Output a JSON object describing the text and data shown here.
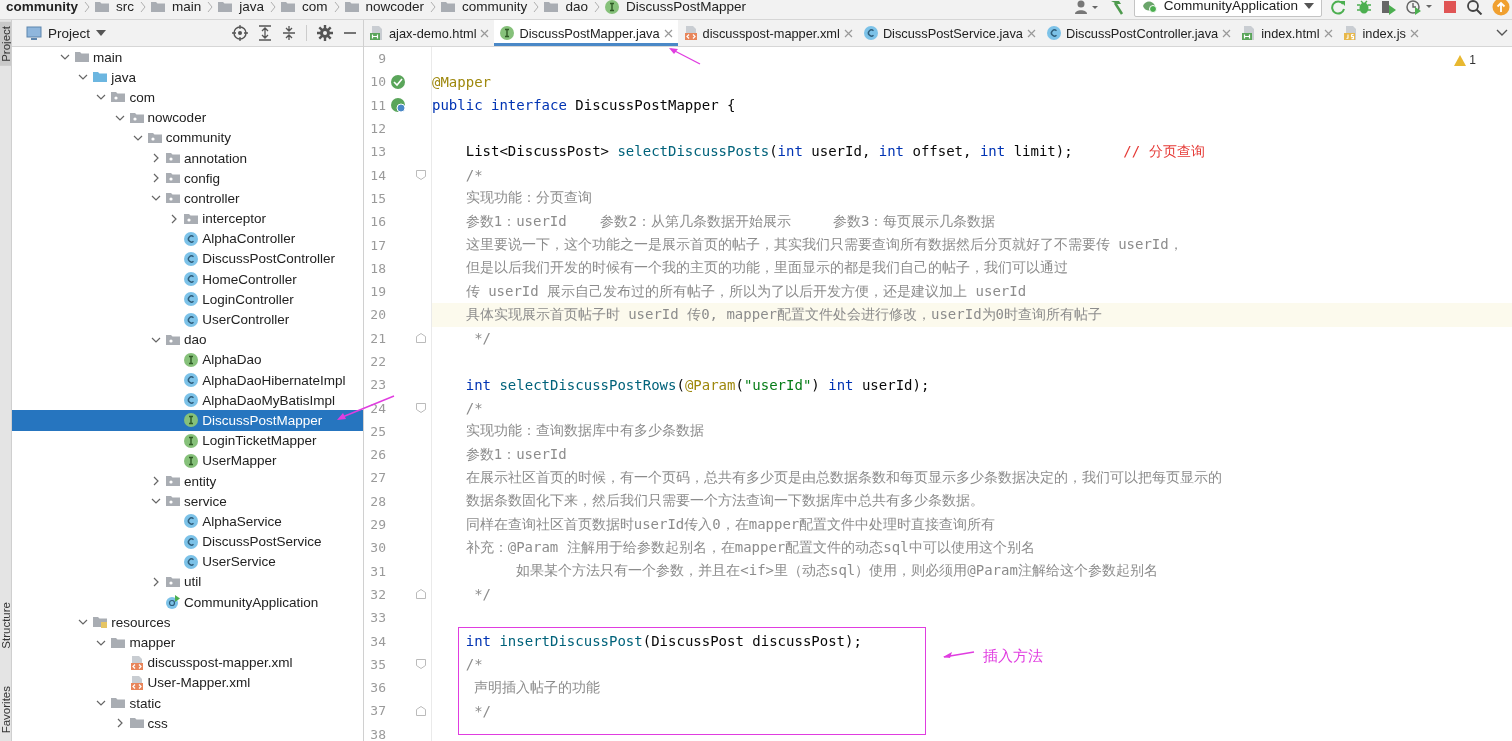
{
  "breadcrumb": [
    {
      "label": "community",
      "kind": "project"
    },
    {
      "label": "src",
      "kind": "folder"
    },
    {
      "label": "main",
      "kind": "folder"
    },
    {
      "label": "java",
      "kind": "folder"
    },
    {
      "label": "com",
      "kind": "folder"
    },
    {
      "label": "nowcoder",
      "kind": "folder"
    },
    {
      "label": "community",
      "kind": "folder"
    },
    {
      "label": "dao",
      "kind": "folder"
    },
    {
      "label": "DiscussPostMapper",
      "kind": "interface"
    }
  ],
  "toolbar": {
    "run_config": "CommunityApplication"
  },
  "tool_strip": [
    {
      "label": "Project",
      "selected": true
    },
    {
      "label": "Structure",
      "selected": false
    },
    {
      "label": "Favorites",
      "selected": false
    }
  ],
  "project_panel": {
    "title": "Project",
    "tree": [
      {
        "label": "main",
        "kind": "folder",
        "expanded": true,
        "selected": false,
        "children": [
          {
            "label": "java",
            "kind": "source-root",
            "expanded": true,
            "selected": false,
            "children": [
              {
                "label": "com",
                "kind": "package",
                "expanded": true,
                "selected": false,
                "children": [
                  {
                    "label": "nowcoder",
                    "kind": "package",
                    "expanded": true,
                    "selected": false,
                    "children": [
                      {
                        "label": "community",
                        "kind": "package",
                        "expanded": true,
                        "selected": false,
                        "children": [
                          {
                            "label": "annotation",
                            "kind": "package",
                            "expanded": false,
                            "selected": false
                          },
                          {
                            "label": "config",
                            "kind": "package",
                            "expanded": false,
                            "selected": false
                          },
                          {
                            "label": "controller",
                            "kind": "package",
                            "expanded": true,
                            "selected": false,
                            "children": [
                              {
                                "label": "interceptor",
                                "kind": "package",
                                "expanded": false,
                                "selected": false
                              },
                              {
                                "label": "AlphaController",
                                "kind": "class",
                                "selected": false
                              },
                              {
                                "label": "DiscussPostController",
                                "kind": "class",
                                "selected": false
                              },
                              {
                                "label": "HomeController",
                                "kind": "class",
                                "selected": false
                              },
                              {
                                "label": "LoginController",
                                "kind": "class",
                                "selected": false
                              },
                              {
                                "label": "UserController",
                                "kind": "class",
                                "selected": false
                              }
                            ]
                          },
                          {
                            "label": "dao",
                            "kind": "package",
                            "expanded": true,
                            "selected": false,
                            "children": [
                              {
                                "label": "AlphaDao",
                                "kind": "interface",
                                "selected": false
                              },
                              {
                                "label": "AlphaDaoHibernateImpl",
                                "kind": "class",
                                "selected": false
                              },
                              {
                                "label": "AlphaDaoMyBatisImpl",
                                "kind": "class",
                                "selected": false
                              },
                              {
                                "label": "DiscussPostMapper",
                                "kind": "interface",
                                "selected": true
                              },
                              {
                                "label": "LoginTicketMapper",
                                "kind": "interface",
                                "selected": false
                              },
                              {
                                "label": "UserMapper",
                                "kind": "interface",
                                "selected": false
                              }
                            ]
                          },
                          {
                            "label": "entity",
                            "kind": "package",
                            "expanded": false,
                            "selected": false
                          },
                          {
                            "label": "service",
                            "kind": "package",
                            "expanded": true,
                            "selected": false,
                            "children": [
                              {
                                "label": "AlphaService",
                                "kind": "class",
                                "selected": false
                              },
                              {
                                "label": "DiscussPostService",
                                "kind": "class",
                                "selected": false
                              },
                              {
                                "label": "UserService",
                                "kind": "class",
                                "selected": false
                              }
                            ]
                          },
                          {
                            "label": "util",
                            "kind": "package",
                            "expanded": false,
                            "selected": false
                          },
                          {
                            "label": "CommunityApplication",
                            "kind": "app",
                            "selected": false
                          }
                        ]
                      }
                    ]
                  }
                ]
              }
            ]
          },
          {
            "label": "resources",
            "kind": "resources-root",
            "expanded": true,
            "selected": false,
            "children": [
              {
                "label": "mapper",
                "kind": "folder",
                "expanded": true,
                "selected": false,
                "children": [
                  {
                    "label": "discusspost-mapper.xml",
                    "kind": "xml",
                    "selected": false
                  },
                  {
                    "label": "User-Mapper.xml",
                    "kind": "xml",
                    "selected": false
                  }
                ]
              },
              {
                "label": "static",
                "kind": "folder",
                "expanded": true,
                "selected": false,
                "children": [
                  {
                    "label": "css",
                    "kind": "folder",
                    "expanded": false,
                    "selected": false
                  }
                ]
              }
            ]
          }
        ]
      }
    ]
  },
  "editor": {
    "tabs": [
      {
        "label": "ajax-demo.html",
        "kind": "html",
        "selected": false
      },
      {
        "label": "DiscussPostMapper.java",
        "kind": "interface",
        "selected": true
      },
      {
        "label": "discusspost-mapper.xml",
        "kind": "xml",
        "selected": false
      },
      {
        "label": "DiscussPostService.java",
        "kind": "class",
        "selected": false
      },
      {
        "label": "DiscussPostController.java",
        "kind": "class",
        "selected": false
      },
      {
        "label": "index.html",
        "kind": "html",
        "selected": false
      },
      {
        "label": "index.js",
        "kind": "js",
        "selected": false
      }
    ],
    "warnings": "1",
    "callout": "插入方法",
    "lines": [
      {
        "number": "9",
        "current": false,
        "framed": false
      },
      {
        "number": "10",
        "gutter_icon": {
          "kind": "bean"
        },
        "current": false,
        "framed": false,
        "tokens": [
          {
            "kind": "annotation",
            "text": "@Mapper"
          }
        ]
      },
      {
        "number": "11",
        "gutter_icon": {
          "kind": "implemented"
        },
        "current": false,
        "framed": false,
        "tokens": [
          {
            "kind": "keyword",
            "text": "public interface "
          },
          {
            "kind": "plain",
            "text": "DiscussPostMapper {"
          }
        ]
      },
      {
        "number": "12",
        "current": false,
        "framed": false
      },
      {
        "number": "13",
        "current": false,
        "framed": false,
        "tokens": [
          {
            "kind": "plain",
            "text": "    List<DiscussPost> "
          },
          {
            "kind": "method",
            "text": "selectDiscussPosts"
          },
          {
            "kind": "plain",
            "text": "("
          },
          {
            "kind": "keyword",
            "text": "int"
          },
          {
            "kind": "plain",
            "text": " userId, "
          },
          {
            "kind": "keyword",
            "text": "int"
          },
          {
            "kind": "plain",
            "text": " offset, "
          },
          {
            "kind": "keyword",
            "text": "int"
          },
          {
            "kind": "plain",
            "text": " limit);      "
          },
          {
            "kind": "marked-comment",
            "text": "// 分页查询"
          }
        ]
      },
      {
        "number": "14",
        "fold_marker": {
          "kind": "start"
        },
        "current": false,
        "framed": false,
        "tokens": [
          {
            "kind": "comment",
            "text": "    /*"
          }
        ]
      },
      {
        "number": "15",
        "current": false,
        "framed": false,
        "tokens": [
          {
            "kind": "comment",
            "text": "    实现功能：分页查询"
          }
        ]
      },
      {
        "number": "16",
        "current": false,
        "framed": false,
        "tokens": [
          {
            "kind": "comment",
            "text": "    参数1：userId    参数2：从第几条数据开始展示     参数3：每页展示几条数据"
          }
        ]
      },
      {
        "number": "17",
        "current": false,
        "framed": false,
        "tokens": [
          {
            "kind": "comment",
            "text": "    这里要说一下，这个功能之一是展示首页的帖子，其实我们只需要查询所有数据然后分页就好了不需要传 userId，"
          }
        ]
      },
      {
        "number": "18",
        "current": false,
        "framed": false,
        "tokens": [
          {
            "kind": "comment",
            "text": "    但是以后我们开发的时候有一个我的主页的功能，里面显示的都是我们自己的帖子，我们可以通过"
          }
        ]
      },
      {
        "number": "19",
        "current": false,
        "framed": false,
        "tokens": [
          {
            "kind": "comment",
            "text": "    传 userId 展示自己发布过的所有帖子，所以为了以后开发方便，还是建议加上 userId"
          }
        ]
      },
      {
        "number": "20",
        "current": true,
        "framed": false,
        "tokens": [
          {
            "kind": "comment",
            "text": "    具体实现展示首页帖子时 userId 传0, mapper配置文件处会进行修改，userId为0时查询所有帖子"
          }
        ]
      },
      {
        "number": "21",
        "fold_marker": {
          "kind": "end"
        },
        "current": false,
        "framed": false,
        "tokens": [
          {
            "kind": "comment",
            "text": "     */"
          }
        ]
      },
      {
        "number": "22",
        "current": false,
        "framed": false
      },
      {
        "number": "23",
        "current": false,
        "framed": false,
        "tokens": [
          {
            "kind": "keyword",
            "text": "    int "
          },
          {
            "kind": "method",
            "text": "selectDiscussPostRows"
          },
          {
            "kind": "plain",
            "text": "("
          },
          {
            "kind": "annotation",
            "text": "@Param"
          },
          {
            "kind": "plain",
            "text": "("
          },
          {
            "kind": "string",
            "text": "\"userId\""
          },
          {
            "kind": "plain",
            "text": ") "
          },
          {
            "kind": "keyword",
            "text": "int"
          },
          {
            "kind": "plain",
            "text": " userId);"
          }
        ]
      },
      {
        "number": "24",
        "fold_marker": {
          "kind": "start"
        },
        "current": false,
        "framed": false,
        "tokens": [
          {
            "kind": "comment",
            "text": "    /*"
          }
        ]
      },
      {
        "number": "25",
        "current": false,
        "framed": false,
        "tokens": [
          {
            "kind": "comment",
            "text": "    实现功能：查询数据库中有多少条数据"
          }
        ]
      },
      {
        "number": "26",
        "current": false,
        "framed": false,
        "tokens": [
          {
            "kind": "comment",
            "text": "    参数1：userId"
          }
        ]
      },
      {
        "number": "27",
        "current": false,
        "framed": false,
        "tokens": [
          {
            "kind": "comment",
            "text": "    在展示社区首页的时候，有一个页码，总共有多少页是由总数据条数和每页显示多少条数据决定的，我们可以把每页显示的"
          }
        ]
      },
      {
        "number": "28",
        "current": false,
        "framed": false,
        "tokens": [
          {
            "kind": "comment",
            "text": "    数据条数固化下来，然后我们只需要一个方法查询一下数据库中总共有多少条数据。"
          }
        ]
      },
      {
        "number": "29",
        "current": false,
        "framed": false,
        "tokens": [
          {
            "kind": "comment",
            "text": "    同样在查询社区首页数据时userId传入0，在mapper配置文件中处理时直接查询所有"
          }
        ]
      },
      {
        "number": "30",
        "current": false,
        "framed": false,
        "tokens": [
          {
            "kind": "comment",
            "text": "    补充：@Param 注解用于给参数起别名，在mapper配置文件的动态sql中可以使用这个别名"
          }
        ]
      },
      {
        "number": "31",
        "current": false,
        "framed": false,
        "tokens": [
          {
            "kind": "comment",
            "text": "          如果某个方法只有一个参数，并且在<if>里（动态sql）使用，则必须用@Param注解给这个参数起别名"
          }
        ]
      },
      {
        "number": "32",
        "fold_marker": {
          "kind": "end"
        },
        "current": false,
        "framed": false,
        "tokens": [
          {
            "kind": "comment",
            "text": "     */"
          }
        ]
      },
      {
        "number": "33",
        "current": false,
        "framed": false
      },
      {
        "number": "34",
        "current": false,
        "framed": true,
        "tokens": [
          {
            "kind": "keyword",
            "text": "    int "
          },
          {
            "kind": "method",
            "text": "insertDiscussPost"
          },
          {
            "kind": "plain",
            "text": "(DiscussPost discussPost);"
          }
        ]
      },
      {
        "number": "35",
        "fold_marker": {
          "kind": "start"
        },
        "current": false,
        "framed": true,
        "tokens": [
          {
            "kind": "comment",
            "text": "    /*"
          }
        ]
      },
      {
        "number": "36",
        "current": false,
        "framed": true,
        "tokens": [
          {
            "kind": "comment",
            "text": "     声明插入帖子的功能"
          }
        ]
      },
      {
        "number": "37",
        "fold_marker": {
          "kind": "end"
        },
        "current": false,
        "framed": true,
        "tokens": [
          {
            "kind": "comment",
            "text": "     */"
          }
        ]
      },
      {
        "number": "38",
        "current": false,
        "framed": false
      }
    ]
  }
}
